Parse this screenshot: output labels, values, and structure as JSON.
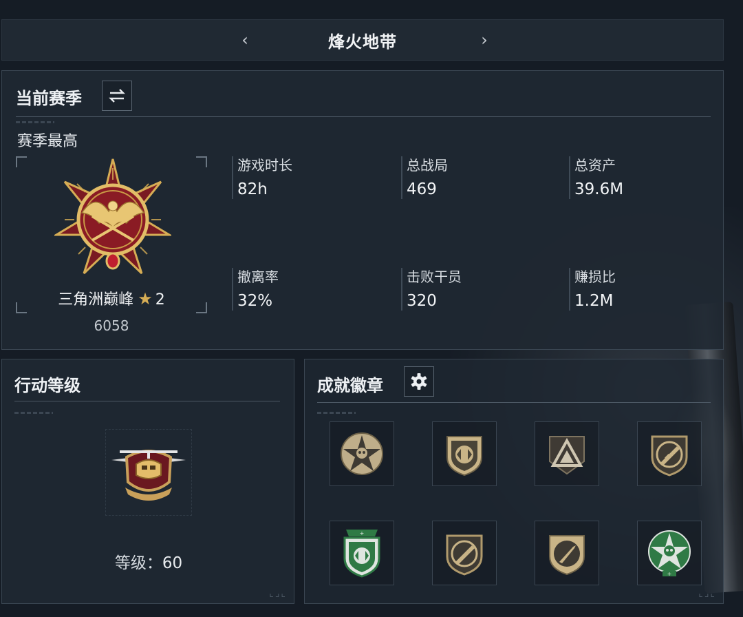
{
  "header": {
    "title": "烽火地带",
    "prev_icon": "chevron-left-icon",
    "next_icon": "chevron-right-icon"
  },
  "season": {
    "heading": "当前赛季",
    "switch_icon": "swap-arrows-icon",
    "best_label": "赛季最高",
    "rank_name": "三角洲巅峰",
    "rank_star_icon": "star-icon",
    "rank_stars": "2",
    "rank_score": "6058",
    "stats": [
      {
        "label": "游戏时长",
        "value": "82h"
      },
      {
        "label": "总战局",
        "value": "469"
      },
      {
        "label": "总资产",
        "value": "39.6M"
      },
      {
        "label": "撤离率",
        "value": "32%"
      },
      {
        "label": "击败干员",
        "value": "320"
      },
      {
        "label": "赚损比",
        "value": "1.2M"
      }
    ]
  },
  "level": {
    "heading": "行动等级",
    "label": "等级：",
    "value": "60",
    "badge_icon": "helicopter-emblem-icon"
  },
  "badges": {
    "heading": "成就徽章",
    "settings_icon": "gear-icon",
    "items": [
      {
        "icon": "skull-star-badge-icon"
      },
      {
        "icon": "arrows-shield-badge-icon"
      },
      {
        "icon": "triangle-badge-icon"
      },
      {
        "icon": "rifle-shield-badge-icon"
      },
      {
        "icon": "green-arrows-shield-badge-icon"
      },
      {
        "icon": "rifle-shield-badge-icon"
      },
      {
        "icon": "knife-shield-badge-icon"
      },
      {
        "icon": "green-skull-star-badge-icon"
      }
    ]
  },
  "colors": {
    "background": "#151c25",
    "panel": "#1f2832",
    "gold": "#d6ad55",
    "crimson": "#7a1a22",
    "green": "#2f7a45"
  }
}
